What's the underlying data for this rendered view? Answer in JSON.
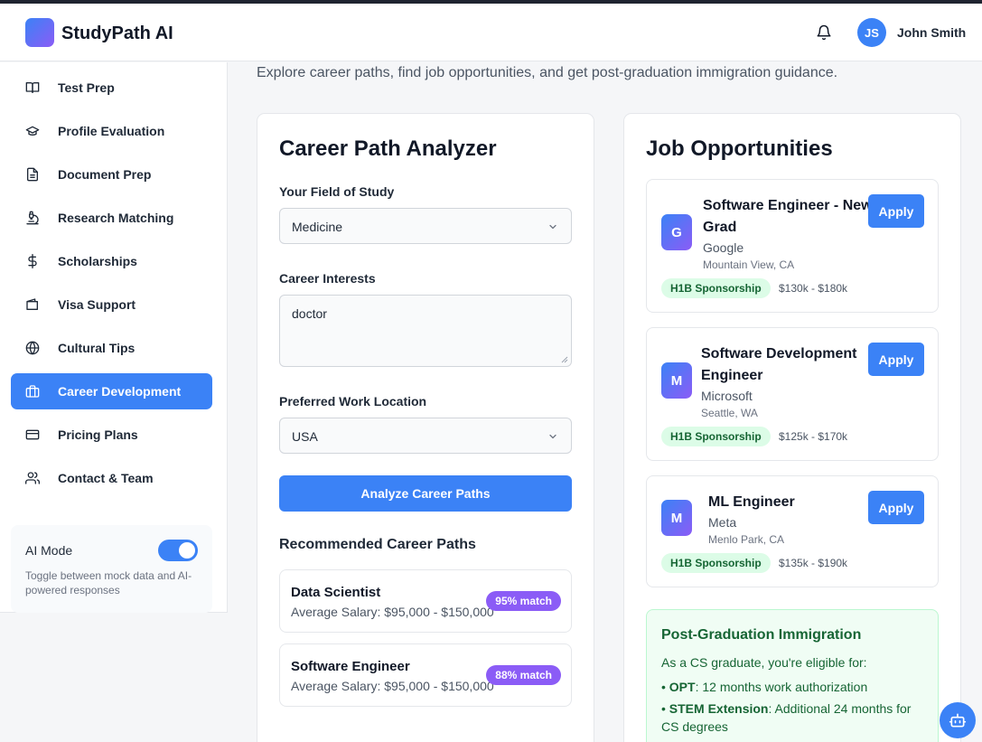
{
  "app": {
    "name": "StudyPath AI",
    "user_initials": "JS",
    "user_name": "John Smith"
  },
  "sidebar": {
    "items": [
      {
        "label": "Test Prep",
        "icon": "book-icon"
      },
      {
        "label": "Profile Evaluation",
        "icon": "graduation-cap-icon"
      },
      {
        "label": "Document Prep",
        "icon": "document-icon"
      },
      {
        "label": "Research Matching",
        "icon": "microscope-icon"
      },
      {
        "label": "Scholarships",
        "icon": "dollar-icon"
      },
      {
        "label": "Visa Support",
        "icon": "wallet-icon"
      },
      {
        "label": "Cultural Tips",
        "icon": "globe-icon"
      },
      {
        "label": "Career Development",
        "icon": "briefcase-icon",
        "active": true
      },
      {
        "label": "Pricing Plans",
        "icon": "credit-card-icon"
      },
      {
        "label": "Contact & Team",
        "icon": "users-icon"
      }
    ],
    "ai_mode": {
      "title": "AI Mode",
      "description": "Toggle between mock data and AI-powered responses",
      "enabled": true
    }
  },
  "intro": "Explore career paths, find job opportunities, and get post-graduation immigration guidance.",
  "analyzer": {
    "title": "Career Path Analyzer",
    "field_label": "Your Field of Study",
    "field_value": "Medicine",
    "interests_label": "Career Interests",
    "interests_value": "doctor",
    "location_label": "Preferred Work Location",
    "location_value": "USA",
    "analyze_button": "Analyze Career Paths",
    "recommended_title": "Recommended Career Paths",
    "paths": [
      {
        "title": "Data Scientist",
        "salary": "Average Salary: $95,000 - $150,000",
        "match": "95% match"
      },
      {
        "title": "Software Engineer",
        "salary": "Average Salary: $95,000 - $150,000",
        "match": "88% match"
      }
    ]
  },
  "jobs": {
    "title": "Job Opportunities",
    "apply_label": "Apply",
    "list": [
      {
        "initial": "G",
        "title_line1": "Software Engineer - New",
        "title_line2": "Grad",
        "company": "Google",
        "location": "Mountain View, CA",
        "tag": "H1B Sponsorship",
        "salary": "$130k - $180k"
      },
      {
        "initial": "M",
        "title_line1": "Software Development",
        "title_line2": "Engineer",
        "company": "Microsoft",
        "location": "Seattle, WA",
        "tag": "H1B Sponsorship",
        "salary": "$125k - $170k"
      },
      {
        "initial": "M",
        "title_line1": "ML Engineer",
        "title_line2": "",
        "company": "Meta",
        "location": "Menlo Park, CA",
        "tag": "H1B Sponsorship",
        "salary": "$135k - $190k"
      }
    ],
    "immigration": {
      "title": "Post-Graduation Immigration",
      "intro": "As a CS graduate, you're eligible for:",
      "opt_term": "OPT",
      "opt_text": ": 12 months work authorization",
      "stem_term": "STEM Extension",
      "stem_text": ": Additional 24 months for CS degrees"
    }
  },
  "colors": {
    "accent": "#3b82f6",
    "purple": "#8b5cf6",
    "green_bg": "#dcfce7",
    "green_text": "#166534"
  }
}
